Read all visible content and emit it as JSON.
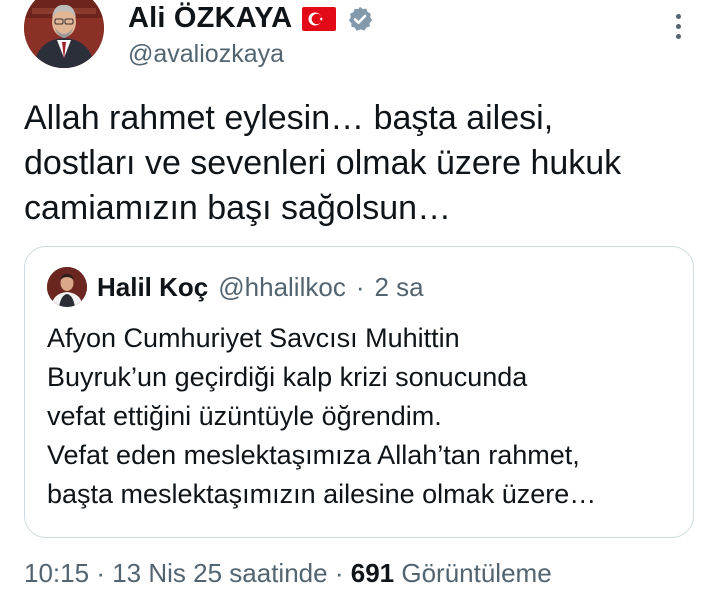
{
  "author": {
    "name": "Ali ÖZKAYA",
    "handle": "@avaliozkaya",
    "flag_icon": "turkey-flag-icon",
    "verified_icon": "verified-badge-icon",
    "verified_color": "#829aab"
  },
  "tweet": {
    "text": "Allah rahmet eylesin… başta ailesi,\ndostları ve sevenleri olmak üzere hukuk\ncamiamızın başı sağolsun…"
  },
  "quote": {
    "name": "Halil Koç",
    "handle": "@hhalilkoc",
    "separator": "·",
    "time": "2 sa",
    "text": "Afyon Cumhuriyet Savcısı Muhittin\nBuyruk’un geçirdiği kalp krizi sonucunda\nvefat ettiğini üzüntüyle öğrendim.\nVefat eden meslektaşımıza Allah’tan rahmet,\nbaşta meslektaşımızın ailesine olmak üzere…"
  },
  "footer": {
    "time": "10:15",
    "date": "13 Nis 25 saatinde",
    "separator": "·",
    "views_count": "691",
    "views_label": "Görüntüleme"
  },
  "colors": {
    "text": "#0f1419",
    "secondary": "#536471",
    "border": "#cfd9de",
    "flag_red": "#e30a17"
  }
}
